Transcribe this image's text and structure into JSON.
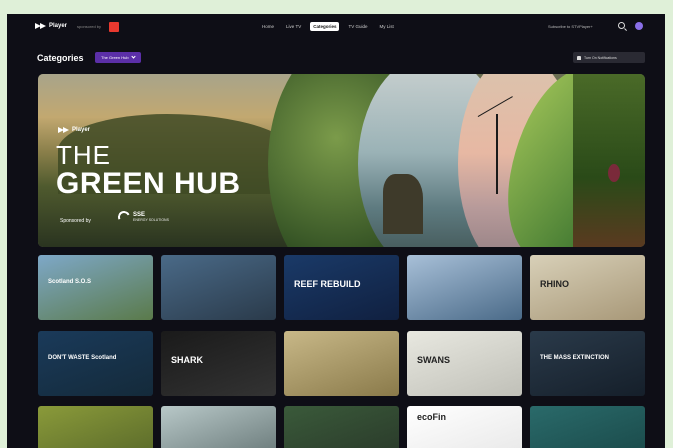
{
  "nav": {
    "logo": "Player",
    "sponsor": "sponsored by",
    "menu": [
      "Home",
      "Live TV",
      "Categories",
      "TV Guide",
      "My List"
    ],
    "active": "Categories",
    "subscribe": "Subscribe to STVPlayer+"
  },
  "page": {
    "title": "Categories",
    "filter_label": "The Green Hub",
    "notify_label": "Turn On Notifications"
  },
  "hero": {
    "logo": "Player",
    "title_line1": "THE",
    "title_line2": "GREEN HUB",
    "sponsored_by": "Sponsored by",
    "sponsor_name": "SSE",
    "sponsor_sub": "ENERGY SOLUTIONS"
  },
  "tiles": [
    {
      "label": "Scotland S.O.S",
      "colors": [
        "#7ea8c8",
        "#5a7a4a"
      ]
    },
    {
      "label": "",
      "colors": [
        "#4a6a88",
        "#2a3a4a"
      ]
    },
    {
      "label": "REEF REBUILD",
      "colors": [
        "#1a3a68",
        "#102040"
      ]
    },
    {
      "label": "",
      "colors": [
        "#a8c0d8",
        "#4a6a88"
      ]
    },
    {
      "label": "RHINO",
      "colors": [
        "#d8d0b8",
        "#a89878"
      ]
    },
    {
      "label": "DON'T WASTE Scotland",
      "colors": [
        "#1a3a5a",
        "#142a3a"
      ]
    },
    {
      "label": "SHARK",
      "colors": [
        "#1a1a1a",
        "#333333"
      ]
    },
    {
      "label": "",
      "colors": [
        "#c8b888",
        "#8a7a4a"
      ]
    },
    {
      "label": "SWANS",
      "colors": [
        "#e8e8e0",
        "#c0c0b8"
      ]
    },
    {
      "label": "THE MASS EXTINCTION",
      "colors": [
        "#2a3a4a",
        "#151f2a"
      ]
    },
    {
      "label": "",
      "colors": [
        "#8a9a3a",
        "#5a6a2a"
      ]
    },
    {
      "label": "",
      "colors": [
        "#b8c8c8",
        "#6a7a7a"
      ]
    },
    {
      "label": "",
      "colors": [
        "#3a5a3a",
        "#2a3a2a"
      ]
    },
    {
      "label": "ecoFin",
      "colors": [
        "#ffffff",
        "#e8e8e8"
      ]
    },
    {
      "label": "",
      "colors": [
        "#2a6a6a",
        "#1a4a4a"
      ]
    }
  ]
}
